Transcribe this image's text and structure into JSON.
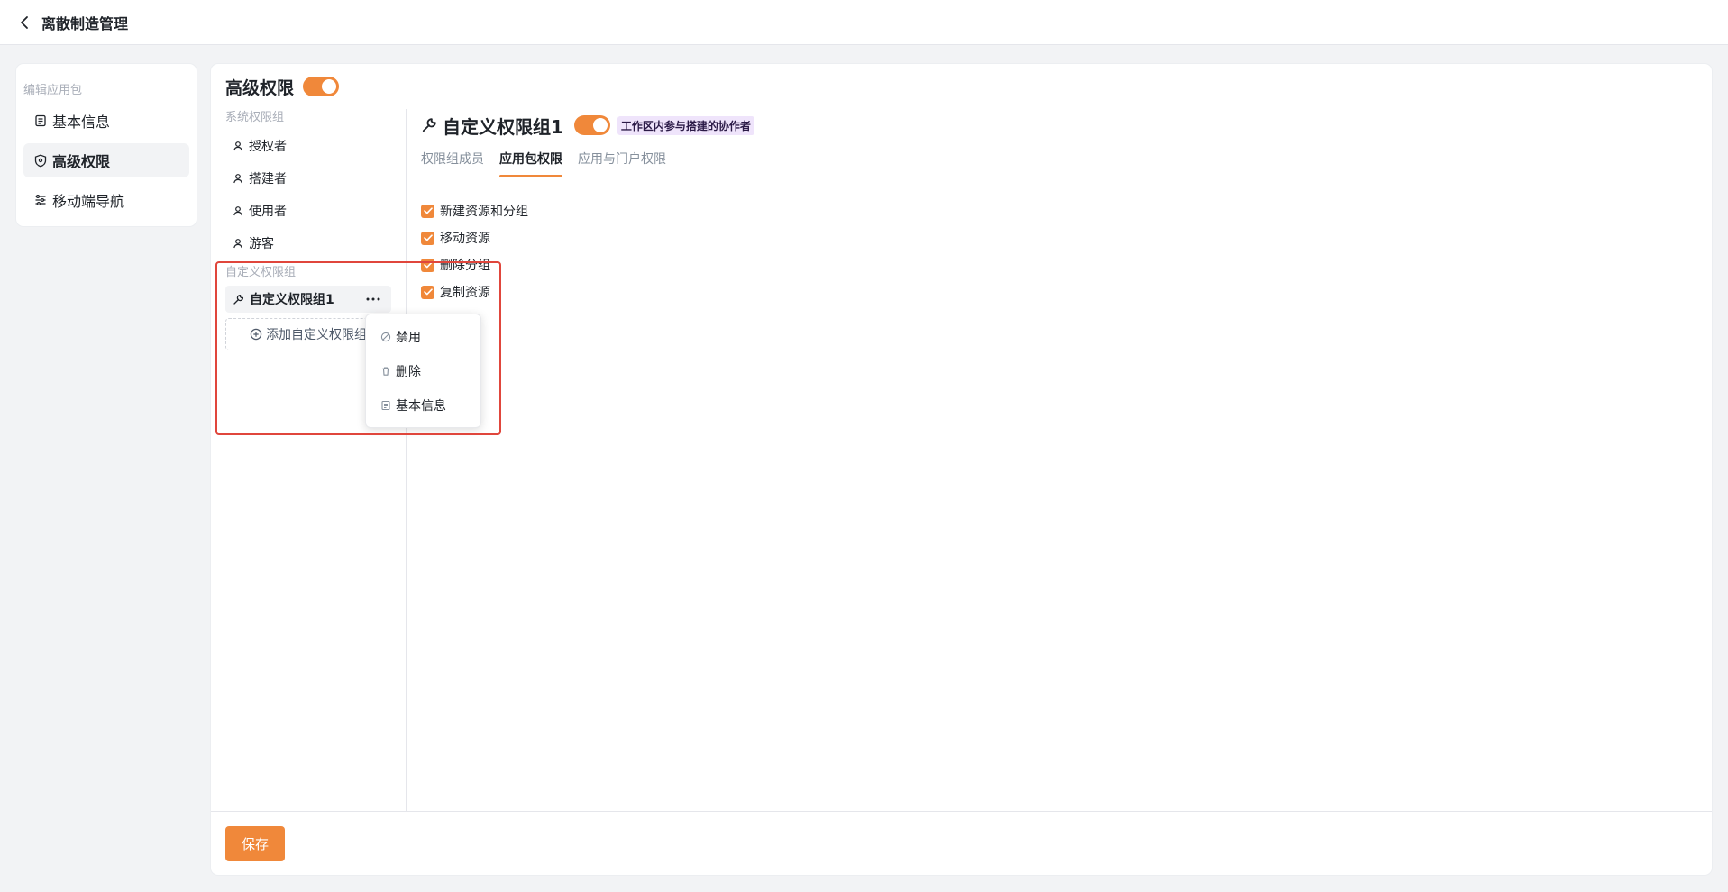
{
  "header": {
    "title": "离散制造管理"
  },
  "sidebar": {
    "section_label": "编辑应用包",
    "items": [
      {
        "label": "基本信息",
        "icon": "document-icon"
      },
      {
        "label": "高级权限",
        "icon": "shield-icon"
      },
      {
        "label": "移动端导航",
        "icon": "sliders-icon"
      }
    ],
    "active_index": 1
  },
  "main": {
    "title": "高级权限",
    "toggle_on": true,
    "system_groups_label": "系统权限组",
    "system_groups": [
      "授权者",
      "搭建者",
      "使用者",
      "游客"
    ],
    "custom_groups_label": "自定义权限组",
    "custom_groups": [
      "自定义权限组1"
    ],
    "add_group_label": "添加自定义权限组",
    "detail": {
      "title": "自定义权限组1",
      "toggle_on": true,
      "tag": "工作区内参与搭建的协作者",
      "tabs": [
        "权限组成员",
        "应用包权限",
        "应用与门户权限"
      ],
      "active_tab": 1,
      "permissions": [
        {
          "label": "新建资源和分组",
          "checked": true
        },
        {
          "label": "移动资源",
          "checked": true
        },
        {
          "label": "删除分组",
          "checked": true
        },
        {
          "label": "复制资源",
          "checked": true
        }
      ]
    },
    "context_menu": [
      {
        "label": "禁用",
        "icon": "ban-icon"
      },
      {
        "label": "删除",
        "icon": "trash-icon"
      },
      {
        "label": "基本信息",
        "icon": "document-icon"
      }
    ]
  },
  "footer": {
    "save_label": "保存"
  },
  "colors": {
    "accent": "#f0883a",
    "highlight": "#e0463c",
    "tag_bg": "#efe4fb"
  }
}
